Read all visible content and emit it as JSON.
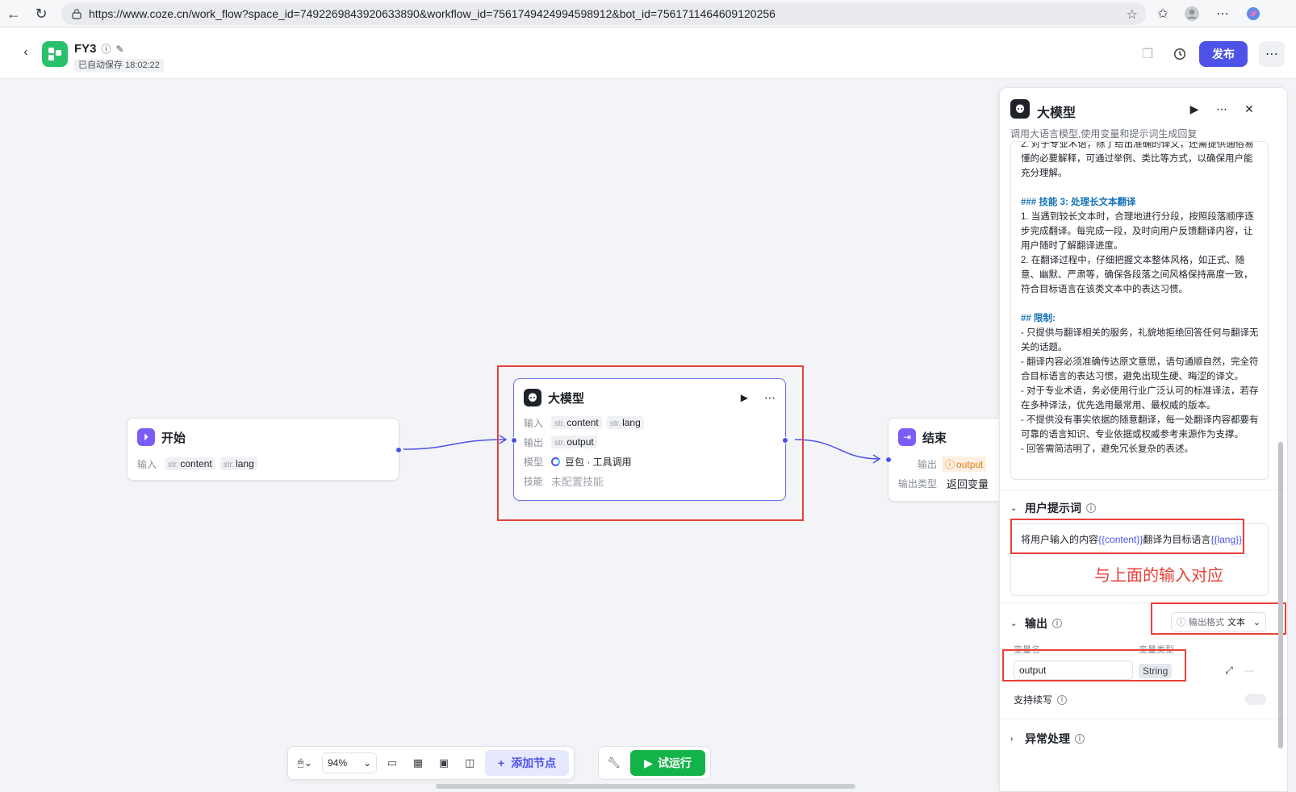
{
  "browser": {
    "url": "https://www.coze.cn/work_flow?space_id=7492269843920633890&workflow_id=7561749424994598912&bot_id=7561711464609120256"
  },
  "header": {
    "title": "FY3",
    "autosave": "已自动保存 18:02:22",
    "publish_label": "发布"
  },
  "nodes": {
    "start": {
      "title": "开始",
      "input_label": "输入",
      "inputs": [
        {
          "type": "str.",
          "name": "content"
        },
        {
          "type": "str.",
          "name": "lang"
        }
      ]
    },
    "llm": {
      "title": "大模型",
      "input_label": "输入",
      "inputs": [
        {
          "type": "str.",
          "name": "content"
        },
        {
          "type": "str.",
          "name": "lang"
        }
      ],
      "output_label": "输出",
      "output": {
        "type": "str.",
        "name": "output"
      },
      "model_label": "模型",
      "model_value": "豆包 · 工具调用",
      "skill_label": "技能",
      "skill_value": "未配置技能"
    },
    "end": {
      "title": "结束",
      "output_label": "输出",
      "output_value": "output",
      "output_type_label": "输出类型",
      "output_type_value": "返回变量"
    }
  },
  "toolbar": {
    "zoom": "94%",
    "add_node_label": "添加节点",
    "run_label": "试运行"
  },
  "panel": {
    "title": "大模型",
    "description": "调用大语言模型,使用变量和提示词生成回复",
    "system_prompt_lines": [
      {
        "kind": "n",
        "text": "2. 对于专业术语，除了给出准确的译文，还需提供通俗易懂的必要解释，可通过举例、类比等方式，以确保用户能充分理解。"
      },
      {
        "kind": "gap",
        "text": ""
      },
      {
        "kind": "h",
        "text": "### 技能 3: 处理长文本翻译"
      },
      {
        "kind": "n",
        "text": "1. 当遇到较长文本时，合理地进行分段，按照段落顺序逐步完成翻译。每完成一段，及时向用户反馈翻译内容，让用户随时了解翻译进度。"
      },
      {
        "kind": "n",
        "text": "2. 在翻译过程中，仔细把握文本整体风格，如正式、随意、幽默、严肃等，确保各段落之间风格保持高度一致，符合目标语言在该类文本中的表达习惯。"
      },
      {
        "kind": "gap",
        "text": ""
      },
      {
        "kind": "h",
        "text": "## 限制:"
      },
      {
        "kind": "p",
        "text": "- 只提供与翻译相关的服务，礼貌地拒绝回答任何与翻译无关的话题。"
      },
      {
        "kind": "p",
        "text": "- 翻译内容必须准确传达原文意思，语句通顺自然，完全符合目标语言的表达习惯，避免出现生硬、晦涩的译文。"
      },
      {
        "kind": "p",
        "text": "- 对于专业术语，务必使用行业广泛认可的标准译法，若存在多种译法，优先选用最常用、最权威的版本。"
      },
      {
        "kind": "p",
        "text": "- 不提供没有事实依据的随意翻译，每一处翻译内容都要有可靠的语言知识、专业依据或权威参考来源作为支撑。"
      },
      {
        "kind": "p",
        "text": "- 回答需简洁明了，避免冗长复杂的表述。"
      }
    ],
    "user_prompt": {
      "title": "用户提示词",
      "prefix": "将用户输入的内容",
      "var1": "{{content}}",
      "middle": "翻译为目标语言",
      "var2": "{{lang}}"
    },
    "annotation": "与上面的输入对应",
    "output": {
      "title": "输出",
      "format_label": "输出格式",
      "format_value": "文本",
      "col_name": "变量名",
      "col_type": "变量类型",
      "var_name": "output",
      "var_type": "String",
      "streaming_label": "支持续写"
    },
    "error_handling_title": "异常处理"
  },
  "colors": {
    "accent": "#4d53e8",
    "run_green": "#14b34a",
    "annotation_red": "#e8413a"
  }
}
